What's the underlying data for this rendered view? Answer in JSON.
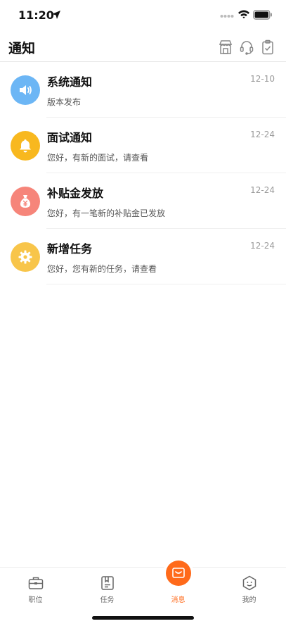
{
  "status_bar": {
    "time": "11:20"
  },
  "header": {
    "title": "通知",
    "icons": [
      "shop-icon",
      "headset-icon",
      "clipboard-icon"
    ]
  },
  "notifications": [
    {
      "title": "系统通知",
      "desc": "版本发布",
      "date": "12-10",
      "icon": "speaker-icon",
      "color": "#6cb6f5"
    },
    {
      "title": "面试通知",
      "desc": "您好，有新的面试，请查看",
      "date": "12-24",
      "icon": "bell-icon",
      "color": "#f8b81f"
    },
    {
      "title": "补贴金发放",
      "desc": "您好，有一笔新的补贴金已发放",
      "date": "12-24",
      "icon": "money-bag-icon",
      "color": "#f6857a"
    },
    {
      "title": "新增任务",
      "desc": "您好，您有新的任务，请查看",
      "date": "12-24",
      "icon": "gear-icon",
      "color": "#f8c54a"
    }
  ],
  "tab_bar": {
    "tabs": [
      {
        "label": "职位",
        "icon": "briefcase-icon"
      },
      {
        "label": "任务",
        "icon": "task-icon"
      },
      {
        "label": "消息",
        "icon": "message-icon",
        "active": true
      },
      {
        "label": "我的",
        "icon": "profile-icon"
      }
    ]
  },
  "colors": {
    "accent": "#ff6a1a"
  }
}
